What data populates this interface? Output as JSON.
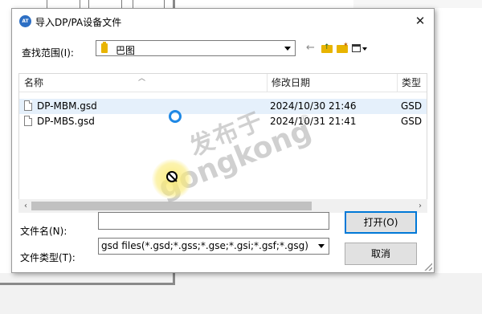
{
  "dialog": {
    "app_icon_text": "AT",
    "title": "导入DP/PA设备文件",
    "close_glyph": "✕"
  },
  "lookin": {
    "label": "查找范围(I):",
    "value": "巴图",
    "folder_icon": "folder-icon"
  },
  "toolbar": {
    "back_glyph": "←",
    "items": [
      "back-icon",
      "up-folder-icon",
      "new-folder-icon",
      "view-menu-icon"
    ]
  },
  "list": {
    "headers": [
      "名称",
      "修改日期",
      "类型"
    ],
    "rows": [
      {
        "name": "DP-MBM.gsd",
        "date": "2024/10/30 21:46",
        "type": "GSD",
        "selected": true
      },
      {
        "name": "DP-MBS.gsd",
        "date": "2024/10/31 21:41",
        "type": "GSD",
        "selected": false
      }
    ],
    "row_highlight": "#e5f0fb"
  },
  "scrollbar": {
    "left_glyph": "‹",
    "right_glyph": "›"
  },
  "filename": {
    "label": "文件名(N):",
    "value": ""
  },
  "filetype": {
    "label": "文件类型(T):",
    "value": "gsd files(*.gsd;*.gss;*.gse;*.gsi;*.gsf;*.gsg)"
  },
  "buttons": {
    "open": "打开(O)",
    "cancel": "取消"
  },
  "accent_color": "#0078d7",
  "watermark": {
    "line1": "发布于",
    "line2": "gongkong",
    "mark": "®"
  }
}
